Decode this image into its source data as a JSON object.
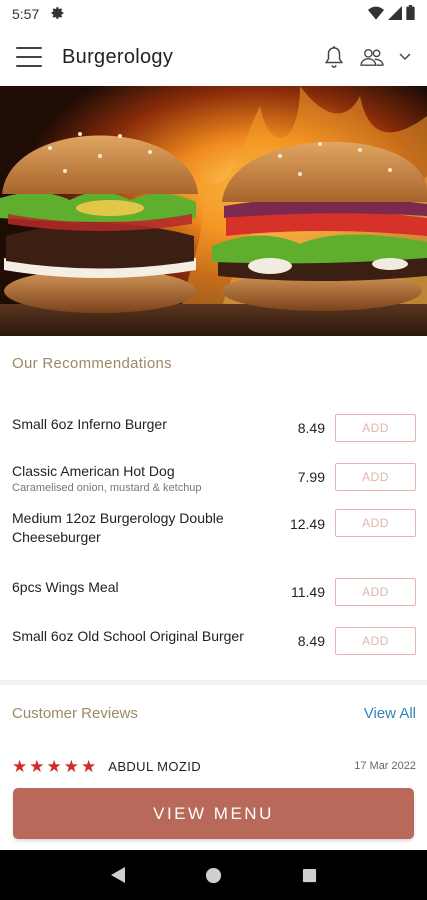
{
  "status_bar": {
    "time": "5:57"
  },
  "app_bar": {
    "title": "Burgerology"
  },
  "recommendations": {
    "title": "Our Recommendations",
    "add_label": "ADD",
    "items": [
      {
        "name": "Small 6oz Inferno Burger",
        "subtitle": "",
        "price": "8.49"
      },
      {
        "name": "Classic American Hot Dog",
        "subtitle": "Caramelised onion, mustard & ketchup",
        "price": "7.99"
      },
      {
        "name": "Medium 12oz Burgerology Double Cheeseburger",
        "subtitle": "",
        "price": "12.49"
      },
      {
        "name": "6pcs Wings Meal",
        "subtitle": "",
        "price": "11.49"
      },
      {
        "name": "Small 6oz Old School Original Burger",
        "subtitle": "",
        "price": "8.49"
      }
    ]
  },
  "reviews": {
    "title": "Customer Reviews",
    "view_all": "View All",
    "first": {
      "reviewer": "ABDUL MOZID",
      "date": "17 Mar 2022",
      "rating": 5
    }
  },
  "view_menu": {
    "label": "VIEW MENU"
  },
  "colors": {
    "section_heading": "#9b8a66",
    "accent_button": "#b8695a",
    "add_border": "#e4b4ad",
    "link": "#2f86b8",
    "star": "#d22a2a"
  },
  "icons": [
    "gear-icon",
    "wifi-icon",
    "signal-icon",
    "battery-icon",
    "menu-icon",
    "bell-icon",
    "users-icon",
    "chevron-down-icon",
    "back-icon",
    "home-icon",
    "recents-icon"
  ]
}
